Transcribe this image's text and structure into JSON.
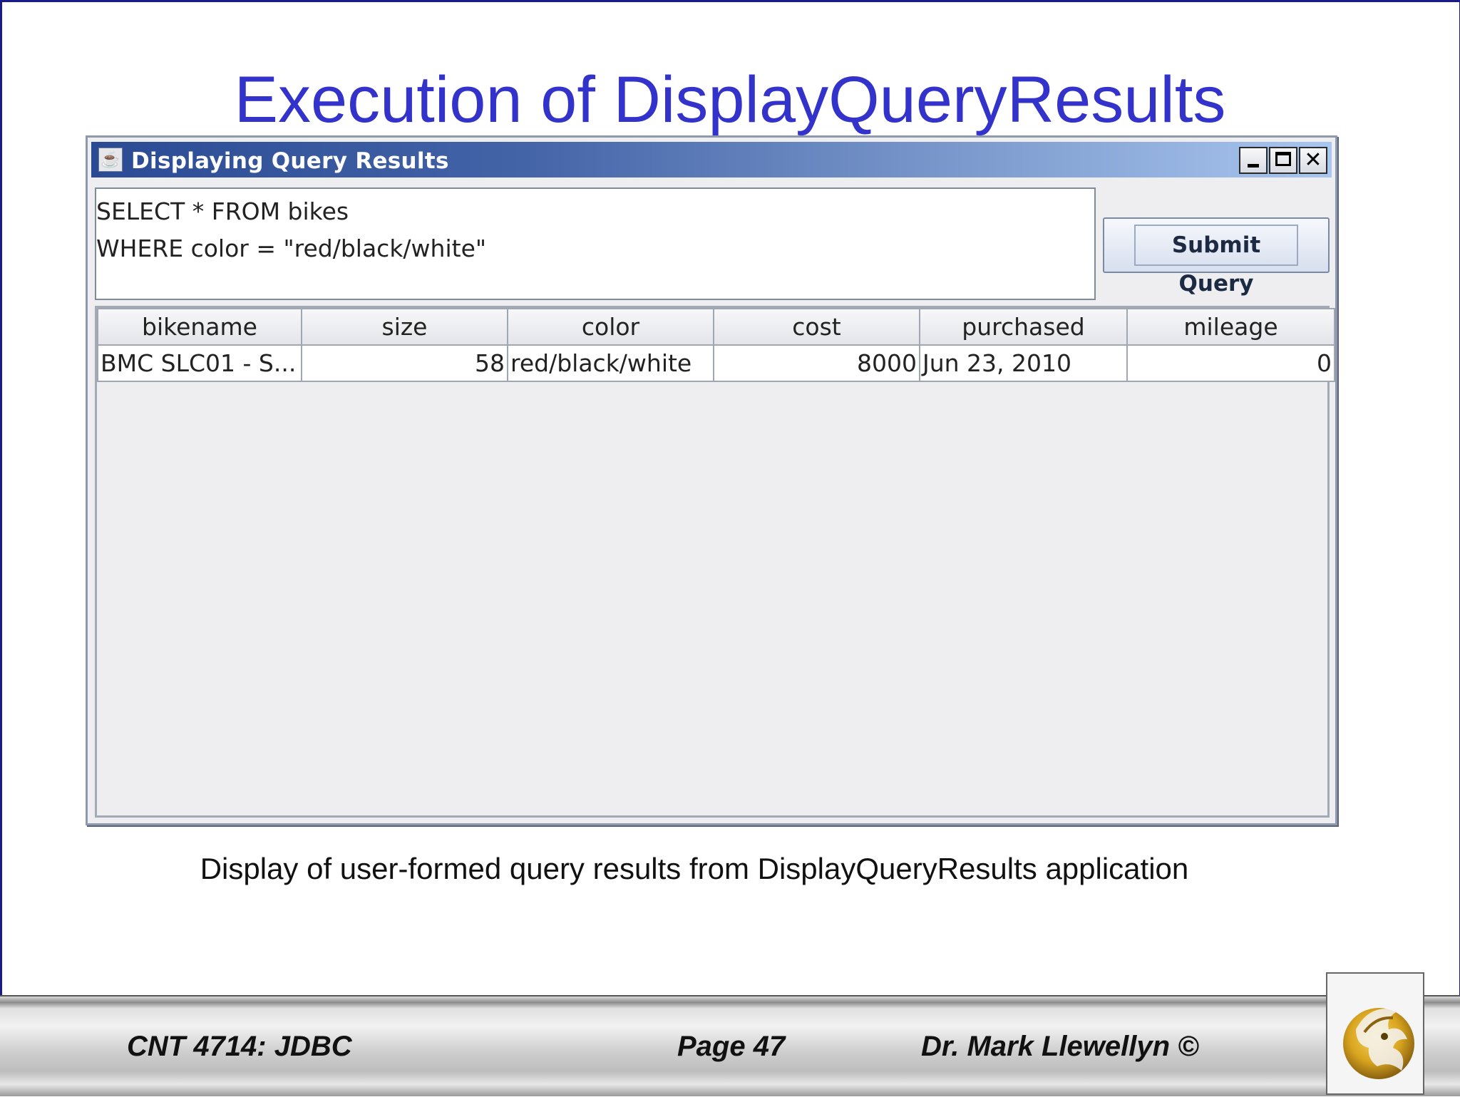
{
  "slide": {
    "title": "Execution of DisplayQueryResults",
    "caption": "Display of user-formed query results from DisplayQueryResults application"
  },
  "window": {
    "title": "Displaying Query Results",
    "controls": {
      "minimize": "_",
      "maximize": "□",
      "close": "✕"
    },
    "query_lines": [
      "SELECT * FROM bikes",
      "WHERE color = \"red/black/white\""
    ],
    "submit_label": "Submit Query"
  },
  "table": {
    "columns": [
      "bikename",
      "size",
      "color",
      "cost",
      "purchased",
      "mileage"
    ],
    "rows": [
      [
        "BMC SLC01 - S...",
        "58",
        "red/black/white",
        "8000",
        "Jun 23, 2010",
        "0"
      ]
    ]
  },
  "footer": {
    "left": "CNT 4714: JDBC",
    "middle": "Page 47",
    "right": "Dr. Mark Llewellyn ©"
  },
  "colors": {
    "title_blue": "#3333cc",
    "titlebar_start": "#2a4a94",
    "titlebar_end": "#a9c6ef",
    "logo_gold": "#d9a520"
  },
  "icons": {
    "app": "java-cup-icon",
    "logo": "pegasus-logo-icon"
  }
}
